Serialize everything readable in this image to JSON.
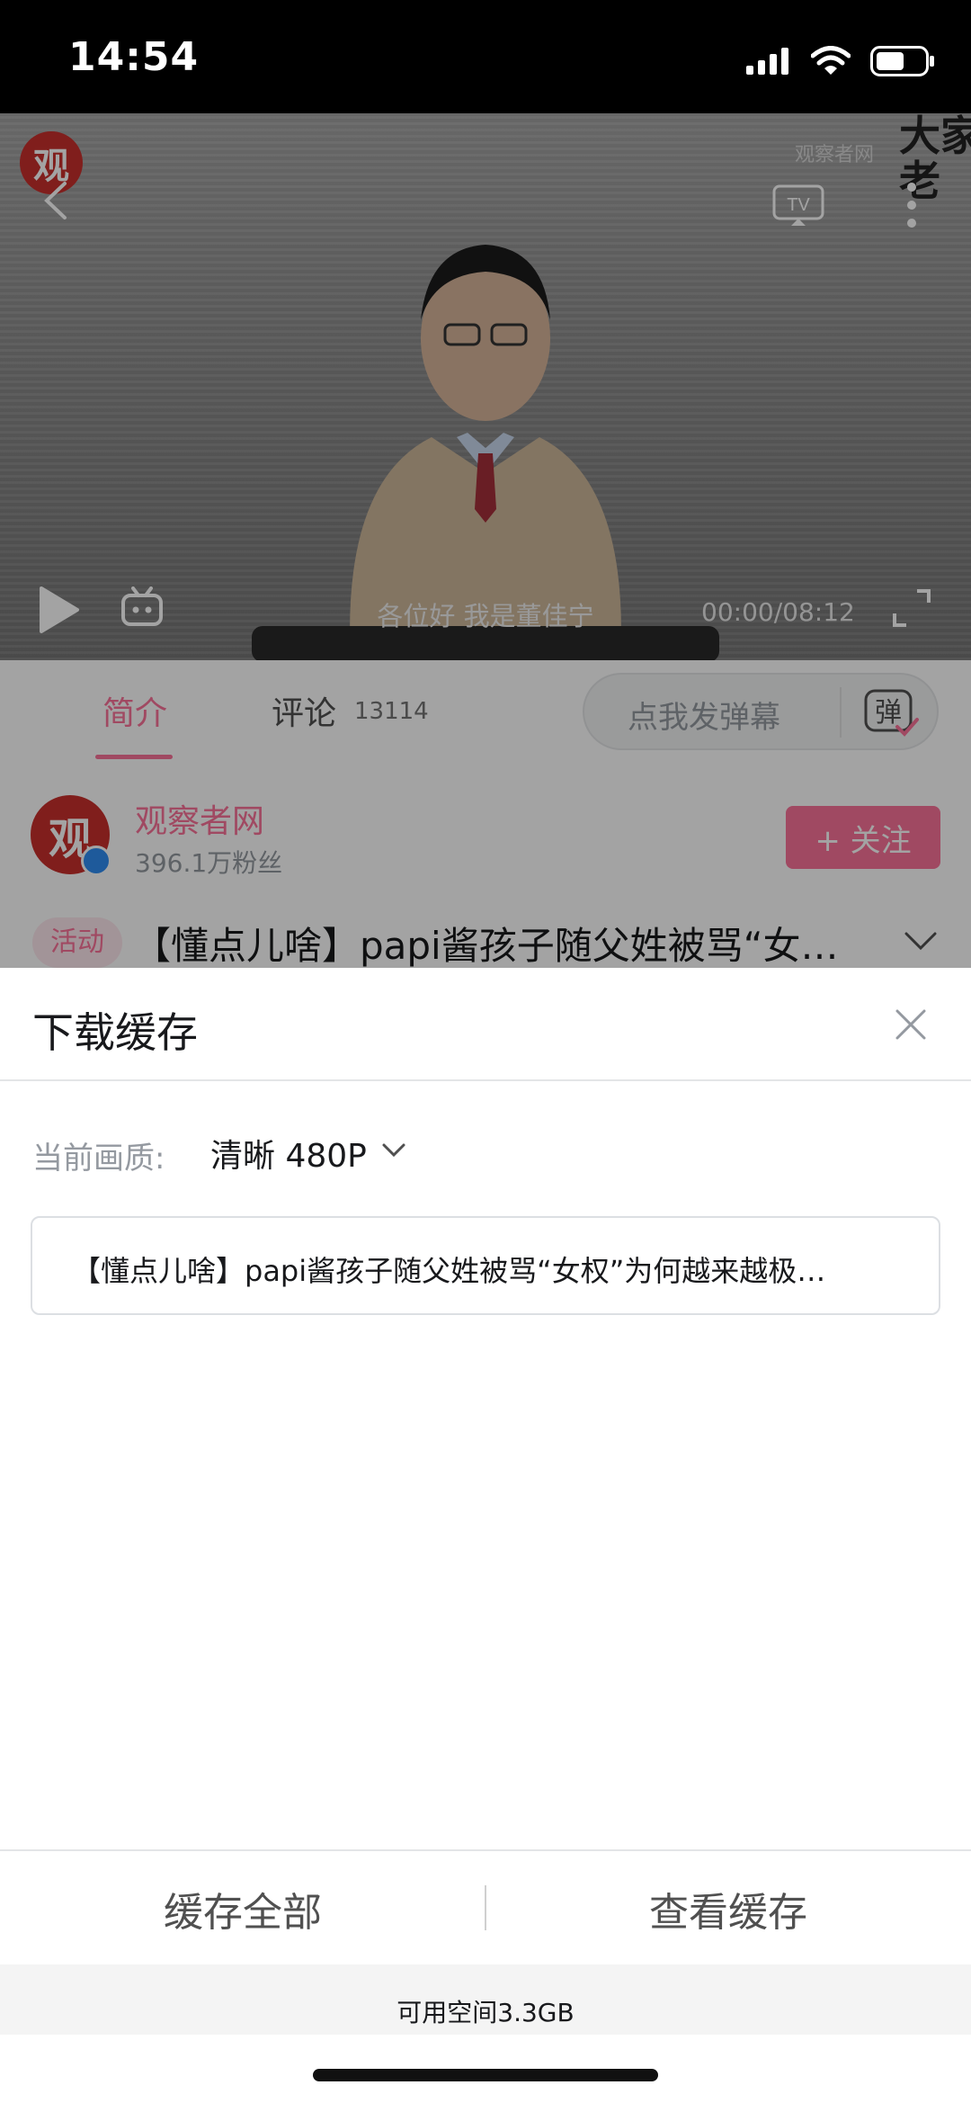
{
  "status_bar": {
    "time": "14:54"
  },
  "video": {
    "channel_badge": "观",
    "watermark": "观察者网",
    "corner_text": "大家\n老",
    "subtitle": "各位好 我是董佳宁",
    "time_code": "00:00/08:12"
  },
  "tabs": {
    "intro": "简介",
    "comments": "评论",
    "comment_count": "13114"
  },
  "danmaku": {
    "placeholder": "点我发弹幕",
    "icon_char": "弹"
  },
  "uploader": {
    "avatar_char": "观",
    "name": "观察者网",
    "fans": "396.1万粉丝",
    "follow_label": "+ 关注"
  },
  "video_info": {
    "tag": "活动",
    "title": "【懂点儿啥】papi酱孩子随父姓被骂“女…"
  },
  "sheet": {
    "title": "下载缓存",
    "quality_label": "当前画质:",
    "quality_value": "清晰 480P",
    "episode_title": "【懂点儿啥】papi酱孩子随父姓被骂“女权”为何越来越极…",
    "cache_all": "缓存全部",
    "view_cache": "查看缓存",
    "storage": "可用空间3.3GB"
  },
  "colors": {
    "accent": "#fb7299",
    "badge_red": "#c9302c"
  }
}
